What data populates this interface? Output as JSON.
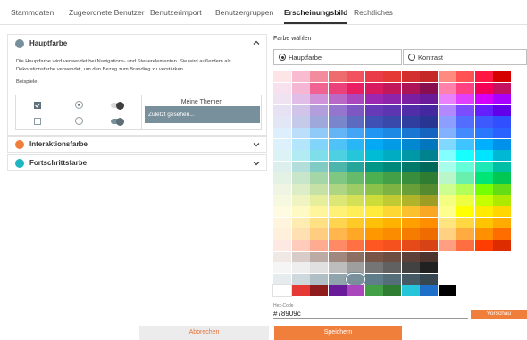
{
  "tabs": [
    {
      "label": "Stammdaten"
    },
    {
      "label": "Zugeordnete Benutzer"
    },
    {
      "label": "Benutzerimport"
    },
    {
      "label": "Benutzergruppen"
    },
    {
      "label": "Erscheinungsbild"
    },
    {
      "label": "Rechtliches"
    }
  ],
  "active_tab": "Erscheinungsbild",
  "sections": {
    "hauptfarbe": {
      "title": "Hauptfarbe",
      "color": "#78909c",
      "description": "Die Hauptfarbe wird verwendet bei Navigations- und Steuerelementen. Sie wird außerdem als Dekorationsfarbe verwendet, um den Bezug zum Branding zu verstärken.",
      "examples_label": "Beispiele:",
      "themes_title": "Meine Themen",
      "themes_recent": "Zuletzt gesehen..."
    },
    "interaktionsfarbe": {
      "title": "Interaktionsfarbe",
      "color": "#f07f3c"
    },
    "fortschrittsfarbe": {
      "title": "Fortschrittsfarbe",
      "color": "#1fb5c2"
    }
  },
  "picker": {
    "label": "Farbe wählen",
    "options": [
      {
        "label": "Hauptfarbe",
        "selected": true
      },
      {
        "label": "Kontrast",
        "selected": false
      }
    ],
    "selected_color": "#78909c",
    "palette": [
      [
        "#fde4e6",
        "#f8bbd0",
        "#f28b9d",
        "#ee6b6e",
        "#f25260",
        "#ea3b48",
        "#e53935",
        "#d32f2f",
        "#c62828",
        "#ff8a80",
        "#ff5252",
        "#ff1744",
        "#d50000"
      ],
      [
        "#f8e1ef",
        "#f4b6d3",
        "#f06292",
        "#ec407a",
        "#e91e63",
        "#d81b60",
        "#c2185b",
        "#ad1457",
        "#880e4f",
        "#ff80ab",
        "#ff4081",
        "#f50057",
        "#c51162"
      ],
      [
        "#efe3f2",
        "#e1bee7",
        "#ce93d8",
        "#ba68c8",
        "#ab47bc",
        "#9c27b0",
        "#8e24aa",
        "#7b1fa2",
        "#6a1b9a",
        "#ea80fc",
        "#e040fb",
        "#d500f9",
        "#aa00ff"
      ],
      [
        "#e7e2f3",
        "#d1c4e9",
        "#b39ddb",
        "#9575cd",
        "#7e57c2",
        "#673ab7",
        "#5e35b1",
        "#512da8",
        "#4527a0",
        "#b388ff",
        "#7c4dff",
        "#651fff",
        "#6200ea"
      ],
      [
        "#e3e6f4",
        "#c5cae9",
        "#9fa8da",
        "#7986cb",
        "#5c6bc0",
        "#3f51b5",
        "#3949ab",
        "#303f9f",
        "#283593",
        "#8c9eff",
        "#536dfe",
        "#3d5afe",
        "#304ffe"
      ],
      [
        "#ddeefc",
        "#bbdefb",
        "#90caf9",
        "#64b5f6",
        "#42a5f5",
        "#2196f3",
        "#1e88e5",
        "#1976d2",
        "#1565c0",
        "#82b1ff",
        "#448aff",
        "#2979ff",
        "#2962ff"
      ],
      [
        "#dcf1fb",
        "#b3e5fc",
        "#81d4fa",
        "#4fc3f7",
        "#29b6f6",
        "#03a9f4",
        "#039be5",
        "#0288d1",
        "#0277bd",
        "#80d8ff",
        "#40c4ff",
        "#00b0ff",
        "#0091ea"
      ],
      [
        "#dcf3f6",
        "#b2ebf2",
        "#80deea",
        "#4dd0e1",
        "#26c6da",
        "#00bcd4",
        "#00acc1",
        "#0097a7",
        "#00838f",
        "#84ffff",
        "#18ffff",
        "#00e5ff",
        "#00b8d4"
      ],
      [
        "#dcefec",
        "#b2dfdb",
        "#80cbc4",
        "#4db6ac",
        "#26a69a",
        "#009688",
        "#00897b",
        "#00796b",
        "#00695c",
        "#a7ffeb",
        "#64ffda",
        "#1de9b6",
        "#00bfa5"
      ],
      [
        "#e3f2e4",
        "#c8e6c9",
        "#a5d6a7",
        "#81c784",
        "#66bb6a",
        "#4caf50",
        "#43a047",
        "#388e3c",
        "#2e7d32",
        "#b9f6ca",
        "#69f0ae",
        "#00e676",
        "#00c853"
      ],
      [
        "#eef5e3",
        "#dcedc8",
        "#c5e1a5",
        "#aed581",
        "#9ccc65",
        "#8bc34a",
        "#7cb342",
        "#689f38",
        "#558b2f",
        "#ccff90",
        "#b2ff59",
        "#76ff03",
        "#64dd17"
      ],
      [
        "#f6f8df",
        "#f0f4c3",
        "#e6ee9c",
        "#dce775",
        "#d4e157",
        "#cddc39",
        "#c0ca33",
        "#afb42b",
        "#9e9d24",
        "#f4ff81",
        "#eeff41",
        "#c6ff00",
        "#aeea00"
      ],
      [
        "#fffbe0",
        "#fff9c4",
        "#fff59d",
        "#fff176",
        "#ffee58",
        "#ffeb3b",
        "#fdd835",
        "#fbc02d",
        "#f9a825",
        "#ffff8d",
        "#ffff00",
        "#ffea00",
        "#ffd600"
      ],
      [
        "#fff5dc",
        "#ffecb3",
        "#ffe082",
        "#ffd54f",
        "#ffca28",
        "#ffc107",
        "#ffb300",
        "#ffa000",
        "#ff8f00",
        "#ffe57f",
        "#ffd740",
        "#ffc400",
        "#ffab00"
      ],
      [
        "#fff0dc",
        "#ffe0b2",
        "#ffcc80",
        "#ffb74d",
        "#ffa726",
        "#ff9800",
        "#fb8c00",
        "#f57c00",
        "#ef6c00",
        "#ffd180",
        "#ffab40",
        "#ff9100",
        "#ff6d00"
      ],
      [
        "#fde8e2",
        "#ffccbc",
        "#ffab91",
        "#ff8a65",
        "#ff7043",
        "#ff5722",
        "#f4511e",
        "#e64a19",
        "#d84315",
        "#ff9e80",
        "#ff6e40",
        "#ff3d00",
        "#dd2c00"
      ],
      [
        "#efe8e5",
        "#d7ccc8",
        "#bcaaa4",
        "#a1887f",
        "#8d6e63",
        "#795548",
        "#6d4c41",
        "#5d4037",
        "#4e342e",
        "",
        "",
        "",
        ""
      ],
      [
        "#f5f5f5",
        "#eeeeee",
        "#e0e0e0",
        "#bdbdbd",
        "#9e9e9e",
        "#757575",
        "#616161",
        "#424242",
        "#212121",
        "",
        "",
        "",
        ""
      ],
      [
        "#e6ebee",
        "#cfd8dc",
        "#b0bec5",
        "#90a4ae",
        "#78909c",
        "#607d8b",
        "#546e7a",
        "#455a64",
        "#37474f",
        "",
        "",
        "",
        ""
      ],
      [
        "#ffffff",
        "#e53935",
        "#8e1c1c",
        "#6a1b9a",
        "#ab47bc",
        "#43a047",
        "#2e7d32",
        "#26c6da",
        "#1e6fc8",
        "#000000",
        "",
        "",
        ""
      ]
    ]
  },
  "hex": {
    "label": "Hex-Code",
    "value": "#78909c"
  },
  "buttons": {
    "preview": "Vorschau",
    "cancel": "Abbrechen",
    "save": "Speichern"
  }
}
